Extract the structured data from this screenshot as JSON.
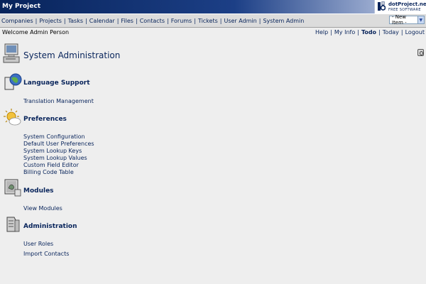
{
  "app": {
    "title": "My Project",
    "logo_name": "dotProject.net",
    "logo_tagline": "FREE SOFTWARE"
  },
  "nav": {
    "items": [
      "Companies",
      "Projects",
      "Tasks",
      "Calendar",
      "Files",
      "Contacts",
      "Forums",
      "Tickets",
      "User Admin",
      "System Admin"
    ],
    "new_item_selected": "- New Item -"
  },
  "user_bar": {
    "welcome": "Welcome Admin Person",
    "links": [
      "Help",
      "My Info",
      "Todo",
      "Today",
      "Logout"
    ]
  },
  "page": {
    "title": "System Administration"
  },
  "sections": [
    {
      "title": "Language Support",
      "icon": "language-icon",
      "links": [
        "Translation Management"
      ]
    },
    {
      "title": "Preferences",
      "icon": "preferences-icon",
      "links": [
        "System Configuration",
        "Default User Preferences",
        "System Lookup Keys",
        "System Lookup Values",
        "Custom Field Editor",
        "Billing Code Table"
      ]
    },
    {
      "title": "Modules",
      "icon": "modules-icon",
      "links": [
        "View Modules"
      ]
    },
    {
      "title": "Administration",
      "icon": "administration-icon",
      "links": [
        "User Roles",
        "Import Contacts"
      ]
    }
  ]
}
